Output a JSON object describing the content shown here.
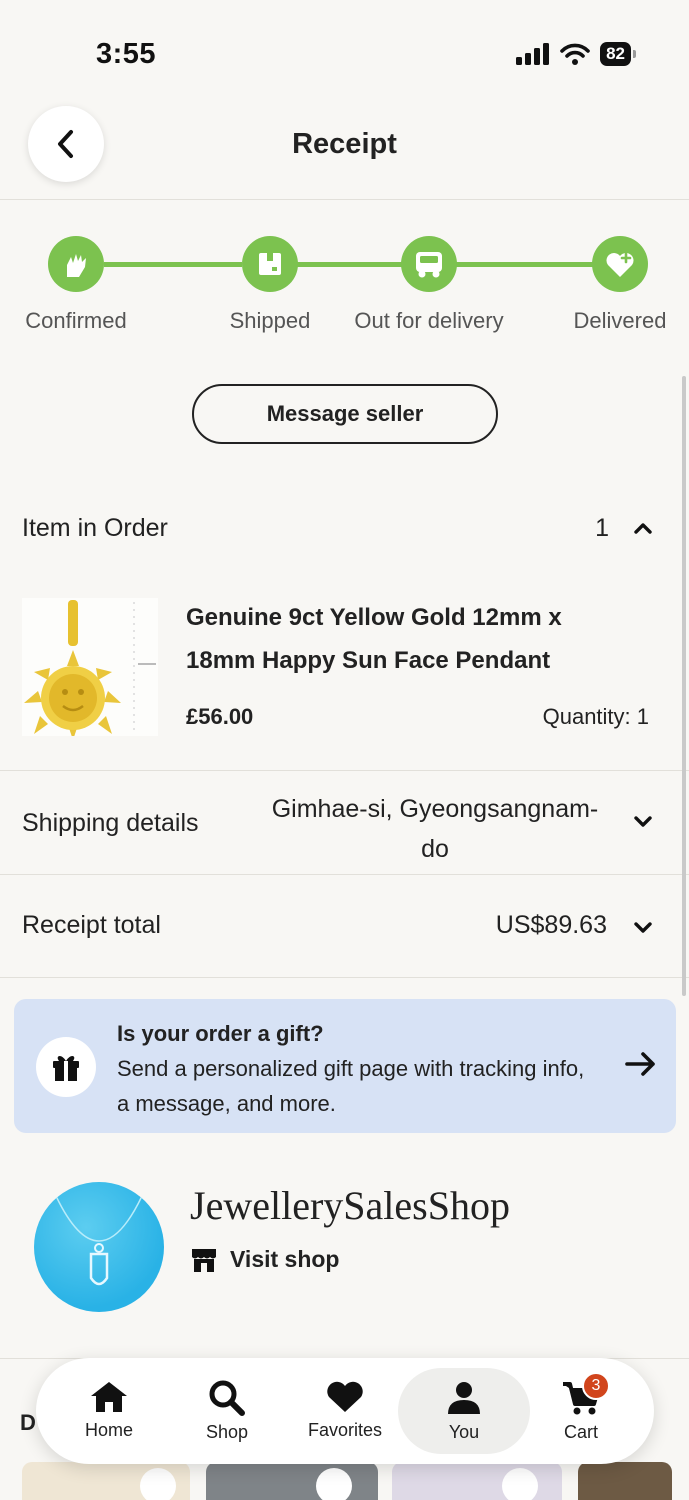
{
  "status": {
    "time": "3:55",
    "battery": "82"
  },
  "header": {
    "title": "Receipt"
  },
  "tracker": {
    "steps": [
      {
        "label": "Confirmed",
        "icon": "hand-heart-icon"
      },
      {
        "label": "Shipped",
        "icon": "box-icon"
      },
      {
        "label": "Out for delivery",
        "icon": "truck-icon"
      },
      {
        "label": "Delivered",
        "icon": "heart-check-icon"
      }
    ],
    "accent": "#7cc24f"
  },
  "actions": {
    "message_seller": "Message seller"
  },
  "order": {
    "heading": "Item in Order",
    "count": "1",
    "item": {
      "title_line1": "Genuine 9ct Yellow Gold 12mm x",
      "title_line2": "18mm Happy Sun Face Pendant",
      "price": "£56.00",
      "quantity": "Quantity: 1"
    }
  },
  "shipping": {
    "label": "Shipping details",
    "value_line1": "Gimhae-si, Gyeongsangnam-",
    "value_line2": "do"
  },
  "receipt": {
    "label": "Receipt total",
    "value": "US$89.63"
  },
  "gift": {
    "title": "Is your order a gift?",
    "desc": "Send a personalized gift page with tracking info, a message, and more.",
    "bg": "#d7e2f5"
  },
  "shop": {
    "name": "JewellerySalesShop",
    "visit": "Visit shop"
  },
  "peek": {
    "letter": "D"
  },
  "nav": {
    "items": [
      {
        "label": "Home",
        "icon": "home-icon"
      },
      {
        "label": "Shop",
        "icon": "search-icon"
      },
      {
        "label": "Favorites",
        "icon": "heart-icon"
      },
      {
        "label": "You",
        "icon": "person-icon"
      },
      {
        "label": "Cart",
        "icon": "cart-icon"
      }
    ],
    "cart_badge": "3",
    "badge_color": "#d1451c"
  }
}
